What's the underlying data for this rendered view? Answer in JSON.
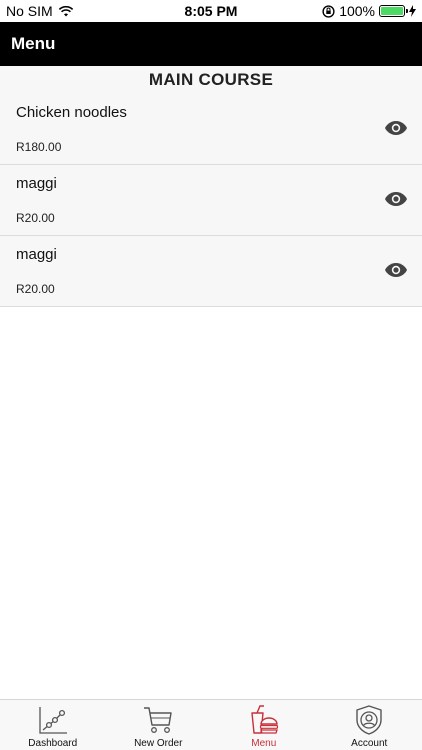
{
  "status_bar": {
    "carrier": "No SIM",
    "time": "8:05 PM",
    "battery_percent": "100%",
    "battery_level": 1.0
  },
  "nav": {
    "title": "Menu"
  },
  "section": {
    "title": "MAIN COURSE"
  },
  "items": [
    {
      "name": "Chicken noodles",
      "price": "R180.00",
      "action_icon": "eye-icon"
    },
    {
      "name": "maggi",
      "price": "R20.00",
      "action_icon": "eye-icon"
    },
    {
      "name": "maggi",
      "price": "R20.00",
      "action_icon": "eye-icon"
    }
  ],
  "tabs": [
    {
      "label": "Dashboard",
      "icon": "chart-icon",
      "active": false
    },
    {
      "label": "New Order",
      "icon": "cart-icon",
      "active": false
    },
    {
      "label": "Menu",
      "icon": "food-icon",
      "active": true
    },
    {
      "label": "Account",
      "icon": "account-shield-icon",
      "active": false
    }
  ],
  "colors": {
    "nav_bg": "#000000",
    "active_tab": "#c9303a",
    "battery": "#4cd964"
  }
}
